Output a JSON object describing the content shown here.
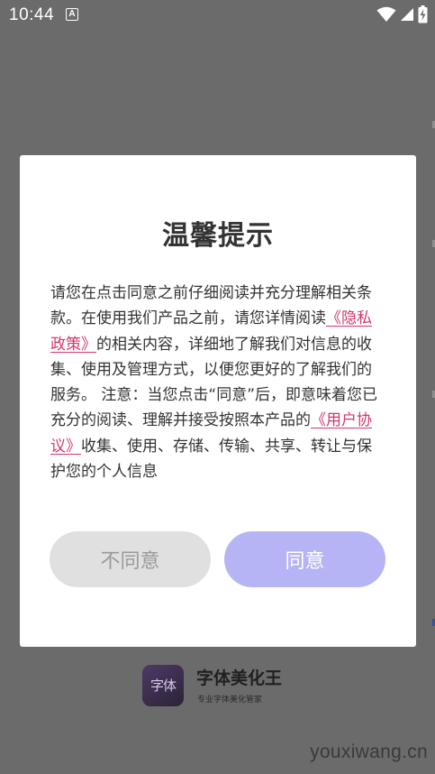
{
  "status_bar": {
    "time": "10:44",
    "notification_icon": "A"
  },
  "dialog": {
    "title": "温馨提示",
    "body": {
      "part1": "请您在点击同意之前仔细阅读并充分理解相关条款。在使用我们产品之前，请您详情阅读",
      "privacy_link": "《隐私政策》",
      "part2": "的相关内容，详细地了解我们对信息的收集、使用及管理方式，以便您更好的了解我们的服务。 注意：当您点击“同意”后，即意味着您已充分的阅读、理解并接受按照本产品的",
      "agreement_link": "《用户协议》",
      "part3": "收集、使用、存储、传输、共享、转让与保护您的个人信息"
    },
    "disagree_label": "不同意",
    "agree_label": "同意"
  },
  "app": {
    "logo_text": "字体",
    "name": "字体美化王",
    "slogan": "专业字体美化管家"
  },
  "watermark": "youxiwang.cn",
  "colors": {
    "overlay": "#6b6b6b",
    "link": "#d4376b",
    "agree_button": "#b6b4f5",
    "disagree_button": "#e0e0e0"
  }
}
